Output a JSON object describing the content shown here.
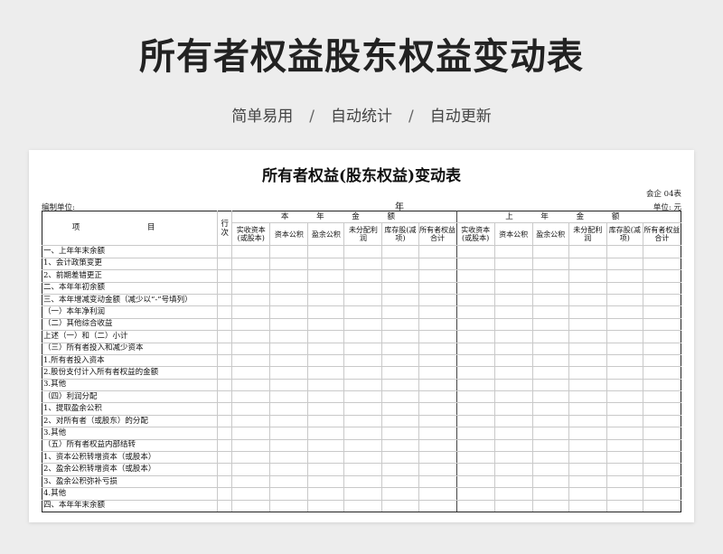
{
  "header": {
    "main_title": "所有者权益股东权益变动表",
    "tags": [
      "简单易用",
      "自动统计",
      "自动更新"
    ],
    "separator": "/"
  },
  "sheet": {
    "title": "所有者权益(股东权益)变动表",
    "form_code": "会企 04表",
    "compiler_label": "编制单位:",
    "year_label": "年",
    "unit_label": "单位: 元",
    "item_header": "项  目",
    "rowno_header": "行次",
    "current_section": "本 年 金 额",
    "prior_section": "上 年 金 额",
    "columns": [
      "实收资本(或股本)",
      "资本公积",
      "盈余公积",
      "未分配利 润",
      "库存股(减项)",
      "所有者权益 合计"
    ],
    "rows": [
      "一、上年年末余额",
      "1、会计政策变更",
      "2、前期差错更正",
      "二、本年年初余额",
      "三、本年增减变动金额（减少以“-”号填列）",
      "（一）本年净利润",
      "（二）其他综合收益",
      "上述（一）和（二）小计",
      "（三）所有者投入和减少资本",
      "1.所有者投入资本",
      "2.股份支付计入所有者权益的金额",
      "3.其他",
      "（四）利润分配",
      "1、提取盈余公积",
      "2、对所有者（或股东）的分配",
      "3.其他",
      "（五）所有者权益内部结转",
      "1、资本公积转增资本（或股本）",
      "2、盈余公积转增资本（或股本）",
      "3、盈余公积弥补亏损",
      "4.其他",
      "四、本年年末余额"
    ]
  }
}
